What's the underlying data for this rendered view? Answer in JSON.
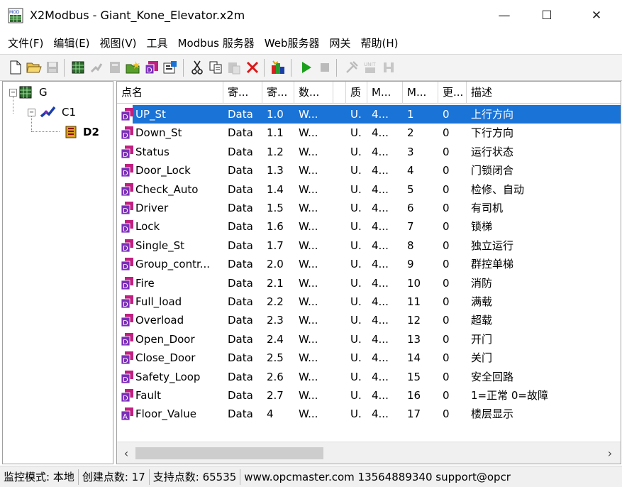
{
  "window": {
    "title": "X2Modbus - Giant_Kone_Elevator.x2m",
    "minimize_glyph": "—",
    "maximize_glyph": "☐",
    "close_glyph": "✕"
  },
  "menu": [
    "文件(F)",
    "编辑(E)",
    "视图(V)",
    "工具",
    "Modbus 服务器",
    "Web服务器",
    "网关",
    "帮助(H)"
  ],
  "toolbar": {
    "icons": [
      "new-file-icon",
      "open-folder-icon",
      "save-icon",
      "add-gateway-icon",
      "add-channel-icon",
      "add-device-icon",
      "add-group-icon",
      "import-icon",
      "properties-icon",
      "cut-icon",
      "copy-icon",
      "paste-icon",
      "delete-icon",
      "auto-configure-icon",
      "run-icon",
      "stop-icon",
      "tools-icon",
      "calc-icon",
      "config-icon"
    ]
  },
  "tree": {
    "root": {
      "label": "G",
      "icon": "gateway-icon"
    },
    "channel": {
      "label": "C1",
      "icon": "channel-icon"
    },
    "device": {
      "label": "D2",
      "icon": "device-icon"
    }
  },
  "list": {
    "columns": [
      "点名",
      "寄...",
      "寄...",
      "数...",
      "",
      "质",
      "M...",
      "M...",
      "更...",
      "描述"
    ],
    "rows": [
      {
        "name": "UP_St",
        "reg_area": "Data",
        "reg_addr": "1.0",
        "dtype": "W...",
        "q": "U.",
        "m1": "4...",
        "m2": "1",
        "upd": "0",
        "desc": "上行方向",
        "selected": true,
        "icon": "tag-icon"
      },
      {
        "name": "Down_St",
        "reg_area": "Data",
        "reg_addr": "1.1",
        "dtype": "W...",
        "q": "U.",
        "m1": "4...",
        "m2": "2",
        "upd": "0",
        "desc": "下行方向",
        "icon": "tag-icon"
      },
      {
        "name": "Status",
        "reg_area": "Data",
        "reg_addr": "1.2",
        "dtype": "W...",
        "q": "U.",
        "m1": "4...",
        "m2": "3",
        "upd": "0",
        "desc": "运行状态",
        "icon": "tag-icon"
      },
      {
        "name": "Door_Lock",
        "reg_area": "Data",
        "reg_addr": "1.3",
        "dtype": "W...",
        "q": "U.",
        "m1": "4...",
        "m2": "4",
        "upd": "0",
        "desc": "门锁闭合",
        "icon": "tag-icon"
      },
      {
        "name": "Check_Auto",
        "reg_area": "Data",
        "reg_addr": "1.4",
        "dtype": "W...",
        "q": "U.",
        "m1": "4...",
        "m2": "5",
        "upd": "0",
        "desc": "检修、自动",
        "icon": "tag-icon"
      },
      {
        "name": "Driver",
        "reg_area": "Data",
        "reg_addr": "1.5",
        "dtype": "W...",
        "q": "U.",
        "m1": "4...",
        "m2": "6",
        "upd": "0",
        "desc": "有司机",
        "icon": "tag-icon"
      },
      {
        "name": "Lock",
        "reg_area": "Data",
        "reg_addr": "1.6",
        "dtype": "W...",
        "q": "U.",
        "m1": "4...",
        "m2": "7",
        "upd": "0",
        "desc": "锁梯",
        "icon": "tag-icon"
      },
      {
        "name": "Single_St",
        "reg_area": "Data",
        "reg_addr": "1.7",
        "dtype": "W...",
        "q": "U.",
        "m1": "4...",
        "m2": "8",
        "upd": "0",
        "desc": "独立运行",
        "icon": "tag-icon"
      },
      {
        "name": "Group_contr...",
        "reg_area": "Data",
        "reg_addr": "2.0",
        "dtype": "W...",
        "q": "U.",
        "m1": "4...",
        "m2": "9",
        "upd": "0",
        "desc": "群控单梯",
        "icon": "tag-icon"
      },
      {
        "name": "Fire",
        "reg_area": "Data",
        "reg_addr": "2.1",
        "dtype": "W...",
        "q": "U.",
        "m1": "4...",
        "m2": "10",
        "upd": "0",
        "desc": "消防",
        "icon": "tag-icon"
      },
      {
        "name": "Full_load",
        "reg_area": "Data",
        "reg_addr": "2.2",
        "dtype": "W...",
        "q": "U.",
        "m1": "4...",
        "m2": "11",
        "upd": "0",
        "desc": "满载",
        "icon": "tag-icon"
      },
      {
        "name": "Overload",
        "reg_area": "Data",
        "reg_addr": "2.3",
        "dtype": "W...",
        "q": "U.",
        "m1": "4...",
        "m2": "12",
        "upd": "0",
        "desc": "超载",
        "icon": "tag-icon"
      },
      {
        "name": "Open_Door",
        "reg_area": "Data",
        "reg_addr": "2.4",
        "dtype": "W...",
        "q": "U.",
        "m1": "4...",
        "m2": "13",
        "upd": "0",
        "desc": "开门",
        "icon": "tag-icon"
      },
      {
        "name": "Close_Door",
        "reg_area": "Data",
        "reg_addr": "2.5",
        "dtype": "W...",
        "q": "U.",
        "m1": "4...",
        "m2": "14",
        "upd": "0",
        "desc": "关门",
        "icon": "tag-icon"
      },
      {
        "name": "Safety_Loop",
        "reg_area": "Data",
        "reg_addr": "2.6",
        "dtype": "W...",
        "q": "U.",
        "m1": "4...",
        "m2": "15",
        "upd": "0",
        "desc": "安全回路",
        "icon": "tag-icon"
      },
      {
        "name": "Fault",
        "reg_area": "Data",
        "reg_addr": "2.7",
        "dtype": "W...",
        "q": "U.",
        "m1": "4...",
        "m2": "16",
        "upd": "0",
        "desc": "1=正常 0=故障",
        "icon": "tag-icon"
      },
      {
        "name": "Floor_Value",
        "reg_area": "Data",
        "reg_addr": "4",
        "dtype": "W...",
        "q": "U.",
        "m1": "4...",
        "m2": "17",
        "upd": "0",
        "desc": "楼层显示",
        "icon": "analog-tag-icon"
      }
    ],
    "scroll_left": "‹",
    "scroll_right": "›"
  },
  "status": {
    "mode": "监控模式: 本地",
    "created": "创建点数: 17",
    "supported": "支持点数: 65535",
    "contact": "www.opcmaster.com 13564889340 support@opcr"
  },
  "colors": {
    "selection": "#1a73d6",
    "tag_icon": "#7b2fb8",
    "run": "#1aa01a"
  }
}
